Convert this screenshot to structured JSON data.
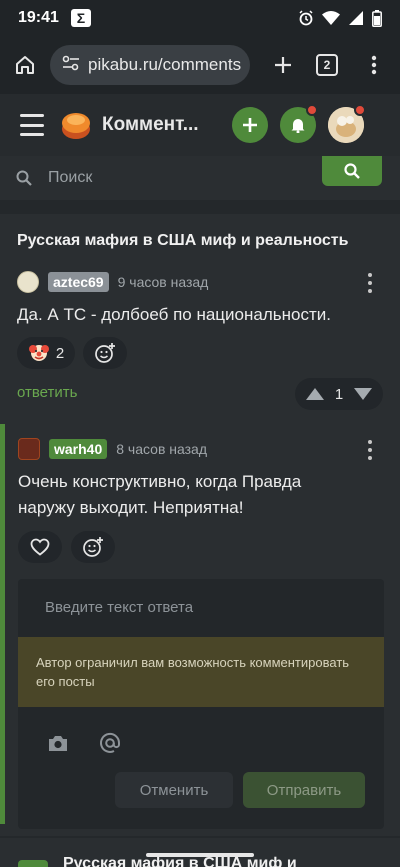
{
  "status_bar": {
    "time": "19:41",
    "badge": "Σ",
    "icons": [
      "alarm-icon",
      "wifi-icon",
      "signal-icon",
      "battery-icon"
    ]
  },
  "browser": {
    "url": "pikabu.ru/comments",
    "tab_count": "2"
  },
  "header": {
    "title": "Коммент..."
  },
  "search": {
    "placeholder": "Поиск"
  },
  "post": {
    "title": "Русская мафия в США миф и реальность"
  },
  "comments": [
    {
      "username": "aztec69",
      "time": "9 часов назад",
      "text": "Да. А ТС - долбоеб по национальности.",
      "reaction_count": "2",
      "reply_label": "ответить",
      "rating": "1"
    },
    {
      "username": "warh40",
      "time": "8 часов назад",
      "text": "Очень конструктивно, когда Правда наружу выходит. Неприятна!"
    }
  ],
  "reply_form": {
    "placeholder": "Введите текст ответа",
    "restriction": "Автор ограничил вам возможность комментировать его посты",
    "cancel_label": "Отменить",
    "send_label": "Отправить"
  },
  "next_post": {
    "title": "Русская мафия в США миф и"
  },
  "colors": {
    "accent": "#4f8a3b",
    "notification": "#e04a3a",
    "background": "#2a2e31"
  }
}
